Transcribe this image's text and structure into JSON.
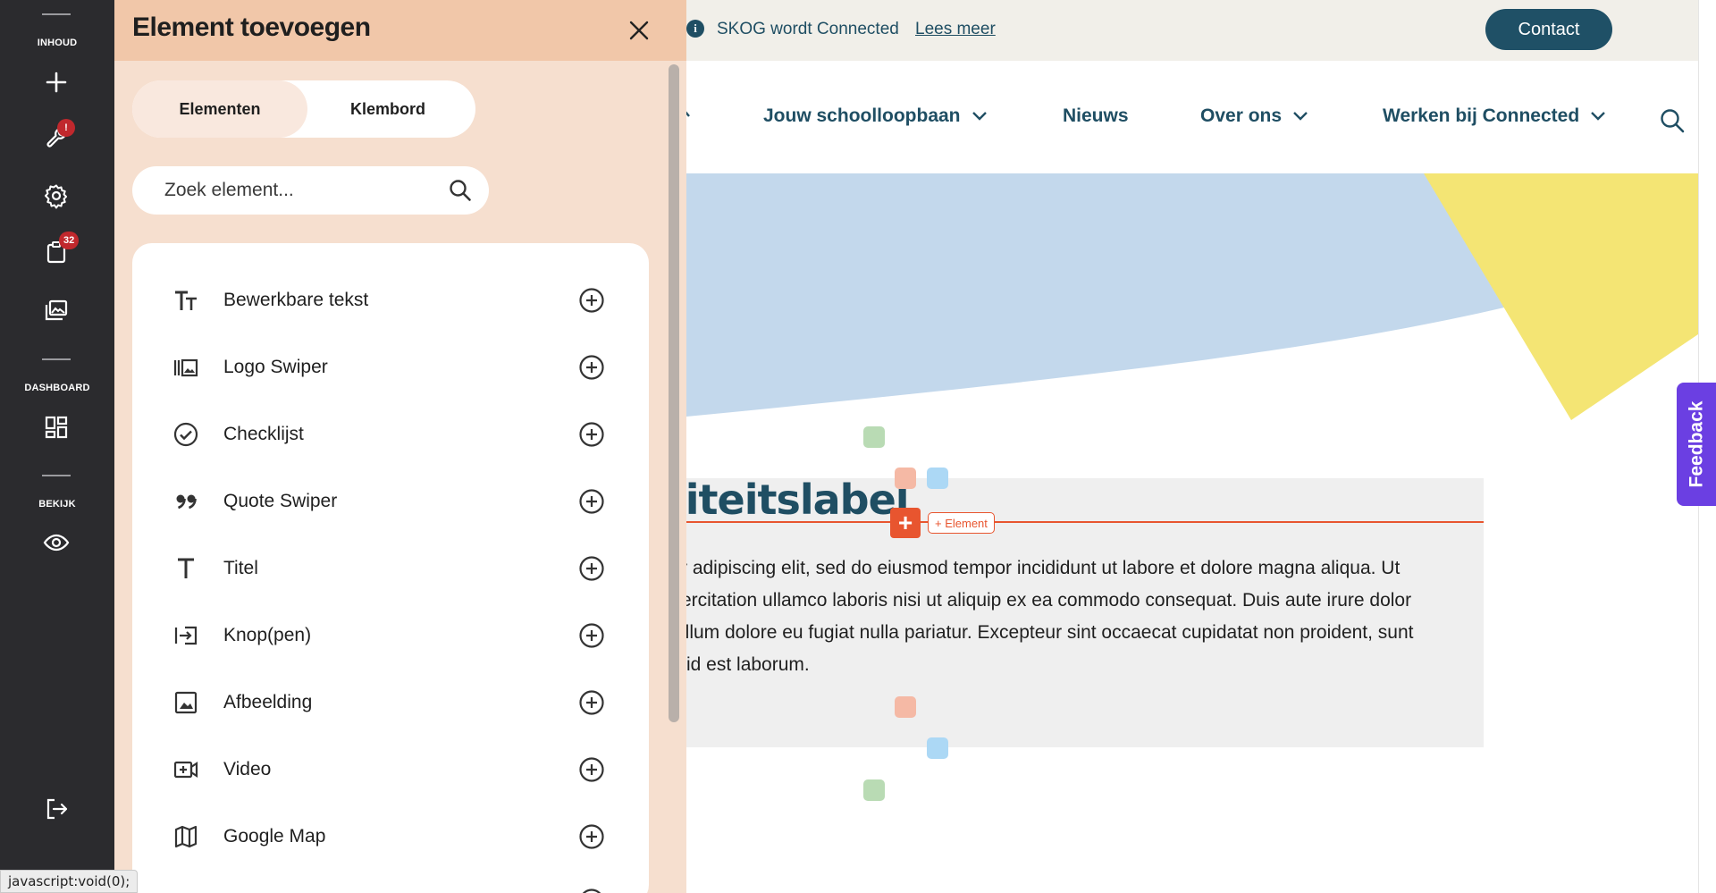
{
  "sidebar": {
    "sections": [
      {
        "label": "INHOUD"
      },
      {
        "label": "DASHBOARD"
      },
      {
        "label": "BEKIJK"
      }
    ],
    "icons": [
      {
        "name": "plus-icon"
      },
      {
        "name": "tools-icon",
        "badge": "!"
      },
      {
        "name": "gear-icon"
      },
      {
        "name": "clipboard-icon",
        "badge": "32"
      },
      {
        "name": "media-library-icon"
      },
      {
        "name": "dashboard-grid-icon"
      },
      {
        "name": "eye-icon"
      },
      {
        "name": "logout-icon"
      }
    ]
  },
  "panel": {
    "title": "Element toevoegen",
    "close_icon": "close-icon",
    "tabs": [
      {
        "label": "Elementen",
        "active": true
      },
      {
        "label": "Klembord",
        "active": false
      }
    ],
    "search": {
      "placeholder": "Zoek element..."
    },
    "items": [
      {
        "label": "Bewerkbare tekst",
        "icon": "text-icon"
      },
      {
        "label": "Logo Swiper",
        "icon": "logo-swiper-icon"
      },
      {
        "label": "Checklijst",
        "icon": "check-circle-icon"
      },
      {
        "label": "Quote Swiper",
        "icon": "quote-icon"
      },
      {
        "label": "Titel",
        "icon": "title-icon"
      },
      {
        "label": "Knop(pen)",
        "icon": "button-icon"
      },
      {
        "label": "Afbeelding",
        "icon": "image-icon"
      },
      {
        "label": "Video",
        "icon": "video-icon"
      },
      {
        "label": "Google Map",
        "icon": "map-icon"
      }
    ]
  },
  "site": {
    "topbar": {
      "info_text": "SKOG wordt Connected",
      "info_link": "Lees meer",
      "contact": "Contact"
    },
    "nav": [
      {
        "label": "Jouw schoolloopbaan",
        "dropdown": true
      },
      {
        "label": "Nieuws",
        "dropdown": false
      },
      {
        "label": "Over ons",
        "dropdown": true
      },
      {
        "label": "Werken bij Connected",
        "dropdown": true
      }
    ],
    "heading": "liteitslabel",
    "element_tag": "+ Element",
    "body_lines": [
      "r adipiscing elit, sed do eiusmod tempor incididunt ut labore et dolore magna aliqua. Ut",
      "ercitation ullamco laboris nisi ut aliquip ex ea commodo consequat. Duis aute irure dolor",
      "illum dolore eu fugiat nulla pariatur. Excepteur sint occaecat cupidatat non proident, sunt",
      "id est laborum."
    ],
    "feedback": "Feedback",
    "colors": {
      "brand_dark": "#1f4e63",
      "accent_red": "#e8552f",
      "hero_blue": "#c3d8ec",
      "hero_yellow": "#f4e574",
      "feedback_purple": "#6b3fe2"
    }
  },
  "statusbar": "javascript:void(0);"
}
